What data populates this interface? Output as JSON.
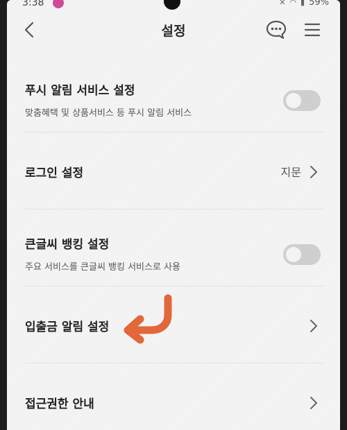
{
  "status_bar": {
    "time": "3:38",
    "battery": "59%"
  },
  "header": {
    "title": "설정"
  },
  "settings": [
    {
      "title": "푸시 알림 서비스 설정",
      "subtitle": "맞춤혜택 및 상품서비스 등 푸시 알림 서비스",
      "toggle_on": false
    },
    {
      "title": "로그인 설정",
      "value": "지문"
    },
    {
      "title": "큰글씨 뱅킹 설정",
      "subtitle": "주요 서비스를 큰글씨 뱅킹 서비스로 사용",
      "toggle_on": false
    },
    {
      "title": "입출금 알림 설정"
    },
    {
      "title": "접근권한 안내"
    }
  ],
  "colors": {
    "background": "#f4f4f4",
    "toggle_off": "#cfcfcf",
    "annotation_arrow": "#e2673a"
  },
  "icons": {
    "back": "chevron-left-icon",
    "chat": "chat-bubble-icon",
    "menu": "hamburger-menu-icon",
    "row_arrow": "chevron-right-icon",
    "annotation": "curved-arrow-icon"
  }
}
